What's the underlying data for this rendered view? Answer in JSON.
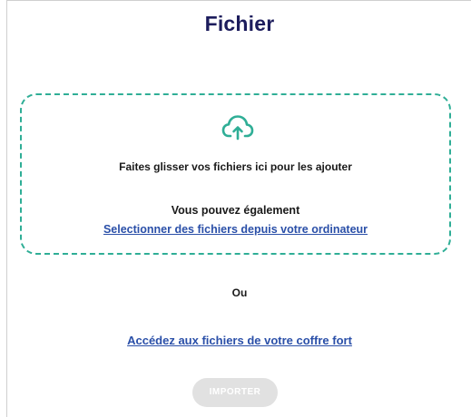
{
  "header": {
    "title": "Fichier"
  },
  "dropzone": {
    "icon": "cloud-upload-icon",
    "drag_text": "Faites glisser vos fichiers ici pour les ajouter",
    "also_text": "Vous pouvez également",
    "select_link": "Selectionner des fichiers depuis votre ordinateur"
  },
  "separator": {
    "or_text": "Ou"
  },
  "vault": {
    "link": "Accédez aux fichiers de votre coffre fort"
  },
  "actions": {
    "import_label": "IMPORTER",
    "import_disabled": true
  },
  "colors": {
    "title": "#1c1c5c",
    "accent": "#2fae96",
    "link": "#2a4fa8",
    "button_disabled": "#e1e1e1"
  }
}
